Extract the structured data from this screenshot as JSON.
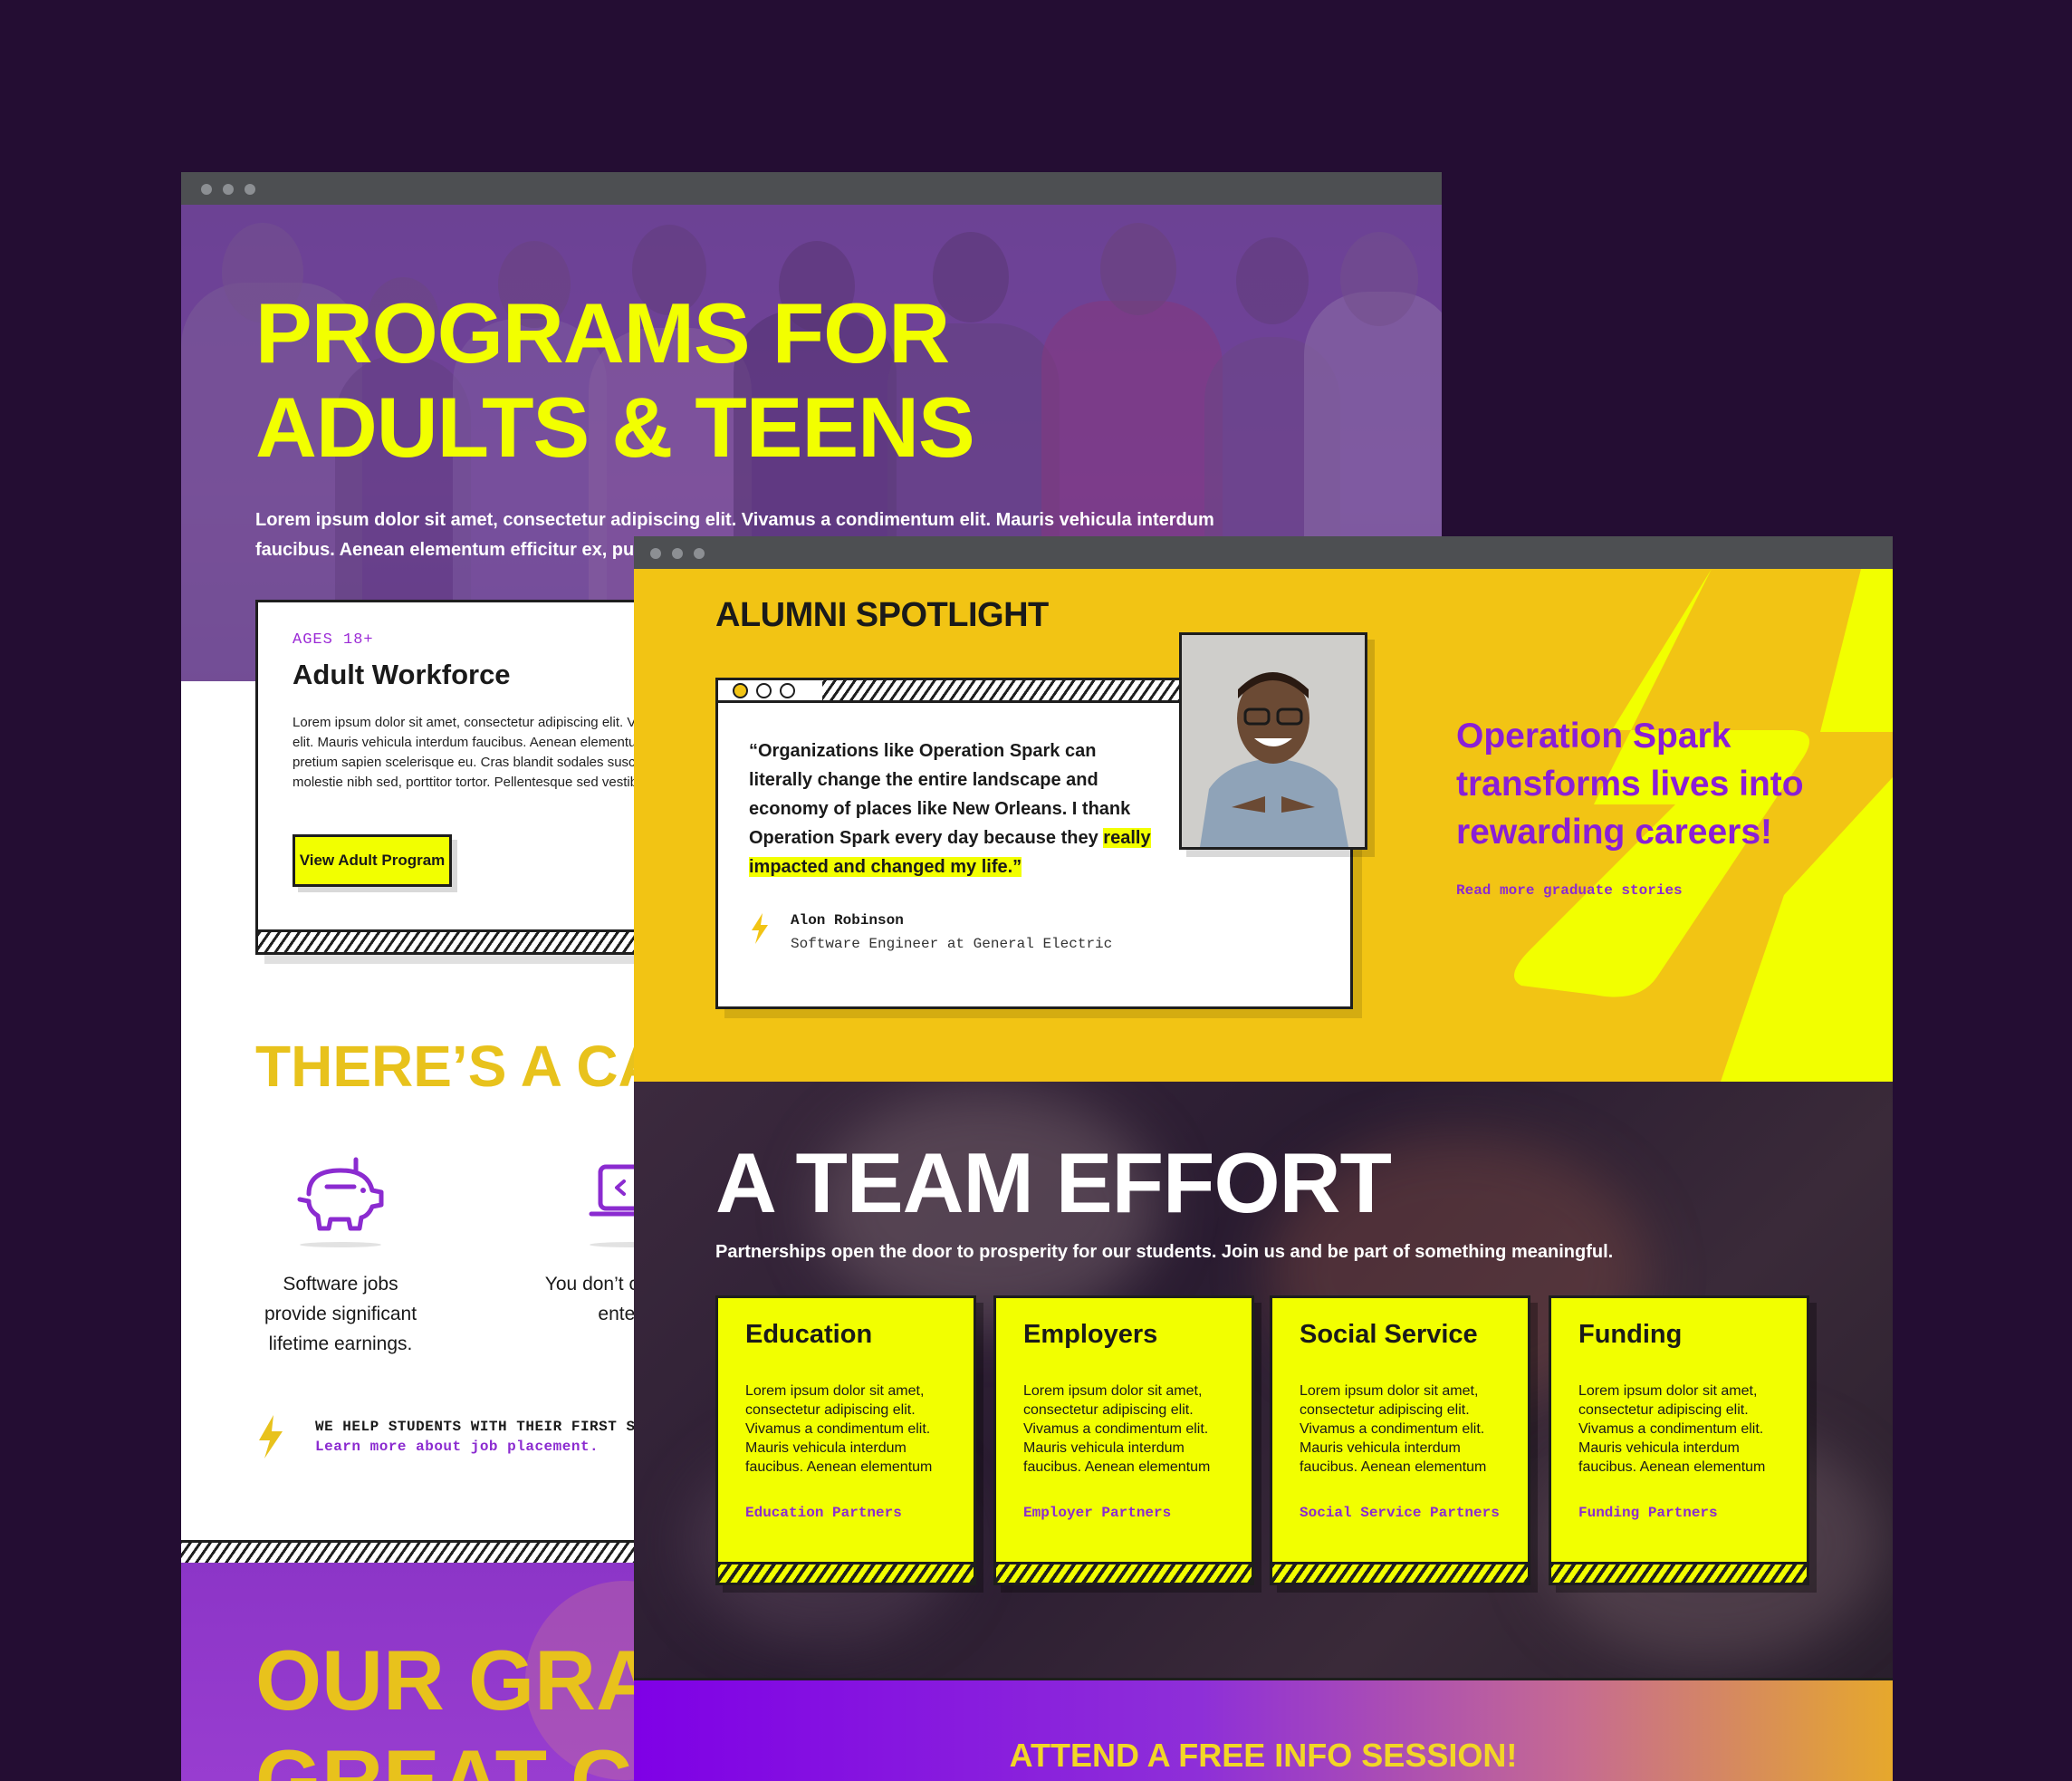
{
  "back_window": {
    "hero_title_line1": "PROGRAMS FOR",
    "hero_title_line2": "ADULTS & TEENS",
    "hero_text": "Lorem ipsum dolor sit amet, consectetur adipiscing elit. Vivamus a condimentum elit. Mauris vehicula interdum faucibus. Aenean elementum efficitur ex, pulvinar pretium sapien scelerisque eu.",
    "card": {
      "ages": "AGES 18+",
      "title": "Adult Workforce",
      "body": "Lorem ipsum dolor sit amet, consectetur adipiscing elit. Vivamus a condimentum elit. Mauris vehicula interdum faucibus. Aenean elementum efficitur ex, pulvinar pretium sapien scelerisque eu. Cras blandit sodales suscipit. Nam id arcu gravida, molestie nibh sed, porttitor tortor. Pellentesque sed vestibulum felis.",
      "button": "View Adult Program"
    },
    "career_heading": "THERE’S A CA",
    "feature1_caption": "Software jobs provide significant lifetime earnings.",
    "feature2_caption": "You don’t college de enter th",
    "help_text": "WE HELP STUDENTS WITH THEIR FIRST S",
    "help_link": "Learn more about job placement.",
    "grads_line1": "OUR GRA",
    "grads_line2": "GREAT C"
  },
  "front_window": {
    "spotlight_title": "ALUMNI SPOTLIGHT",
    "quote_main": "“Organizations like Operation Spark can literally change the entire landscape and economy of places like New Orleans. I thank Operation Spark every day because they",
    "quote_highlight": "really impacted and changed my life.”",
    "person_name": "Alon Robinson",
    "person_role": "Software Engineer at General Electric",
    "tagline": "Operation Spark transforms lives into rewarding careers!",
    "read_more": "Read more graduate stories",
    "team_title": "A TEAM EFFORT",
    "team_subtitle": "Partnerships open the door to prosperity for our students. Join us and be part of something meaningful.",
    "partners": [
      {
        "title": "Education",
        "body": "Lorem ipsum dolor sit amet, consectetur adipiscing elit. Vivamus a condimentum elit. Mauris vehicula interdum faucibus. Aenean elementum",
        "link": "Education Partners"
      },
      {
        "title": "Employers",
        "body": "Lorem ipsum dolor sit amet, consectetur adipiscing elit. Vivamus a condimentum elit. Mauris vehicula interdum faucibus. Aenean elementum",
        "link": "Employer Partners"
      },
      {
        "title": "Social Service",
        "body": "Lorem ipsum dolor sit amet, consectetur adipiscing elit. Vivamus a condimentum elit. Mauris vehicula interdum faucibus. Aenean elementum",
        "link": "Social Service Partners"
      },
      {
        "title": "Funding",
        "body": "Lorem ipsum dolor sit amet, consectetur adipiscing elit. Vivamus a condimentum elit. Mauris vehicula interdum faucibus. Aenean elementum",
        "link": "Funding Partners"
      }
    ],
    "info_session": "ATTEND A FREE INFO SESSION!"
  },
  "icons": [
    "piggy-bank-icon",
    "laptop-code-icon",
    "lightning-bolt-icon"
  ],
  "colors": {
    "page_bg": "#240d33",
    "brand_yellow": "#f2ff00",
    "gold": "#f2c414",
    "purple": "#8b2bd0",
    "dark": "#1e1e1e"
  }
}
